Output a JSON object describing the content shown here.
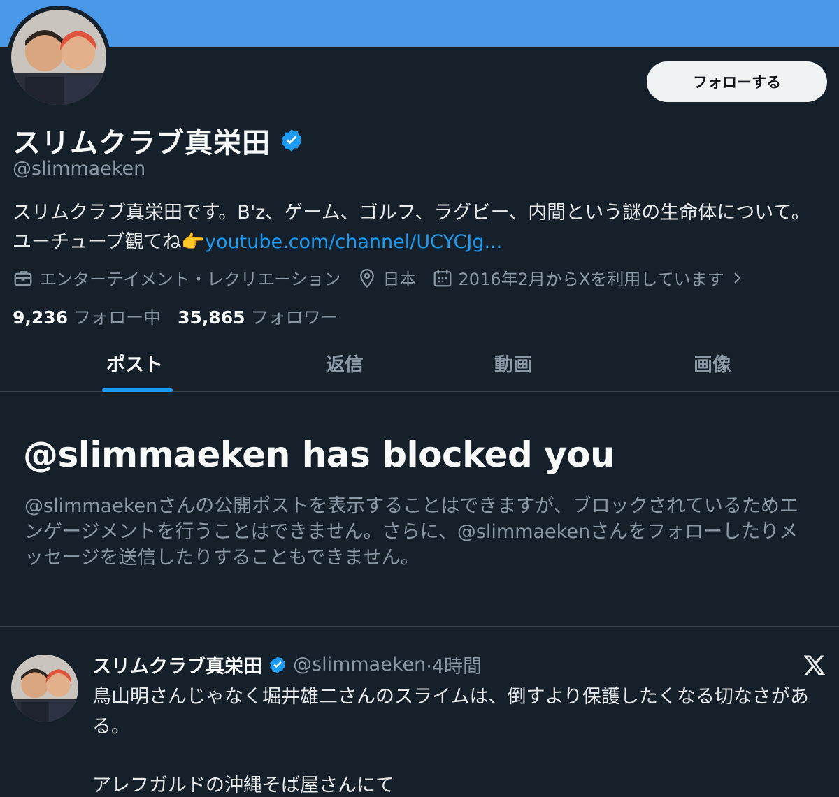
{
  "profile": {
    "display_name": "スリムクラブ真栄田",
    "handle": "@slimmaeken",
    "follow_button": "フォローする",
    "bio_text": "スリムクラブ真栄田です。B'z、ゲーム、ゴルフ、ラグビー、内間という謎の生命体について。ユーチューブ観てね",
    "bio_emoji": "👉",
    "bio_link": "youtube.com/channel/UCYCJg...",
    "category": "エンターテイメント・レクリエーション",
    "location": "日本",
    "joined": "2016年2月からXを利用しています",
    "following_count": "9,236",
    "following_label": "フォロー中",
    "followers_count": "35,865",
    "followers_label": "フォロワー"
  },
  "tabs": [
    {
      "label": "ポスト"
    },
    {
      "label": "返信"
    },
    {
      "label": "動画"
    },
    {
      "label": "画像"
    }
  ],
  "blocked": {
    "title": "@slimmaeken has blocked you",
    "description": "@slimmaekenさんの公開ポストを表示することはできますが、ブロックされているためエンゲージメントを行うことはできません。さらに、@slimmaekenさんをフォローしたりメッセージを送信したりすることもできません。"
  },
  "post": {
    "name": "スリムクラブ真栄田",
    "handle": "@slimmaeken",
    "time": "·4時間",
    "text": "鳥山明さんじゃなく堀井雄二さんのスライムは、倒すより保護したくなる切なさがある。",
    "text2": "アレフガルドの沖縄そば屋さんにて"
  },
  "colors": {
    "background": "#15202b",
    "banner": "#4a99e9",
    "accent": "#1d9bf0",
    "muted": "#8b98a5"
  },
  "icons": [
    "verified-badge-icon",
    "briefcase-icon",
    "location-pin-icon",
    "calendar-icon",
    "chevron-right-icon",
    "x-logo-icon"
  ]
}
